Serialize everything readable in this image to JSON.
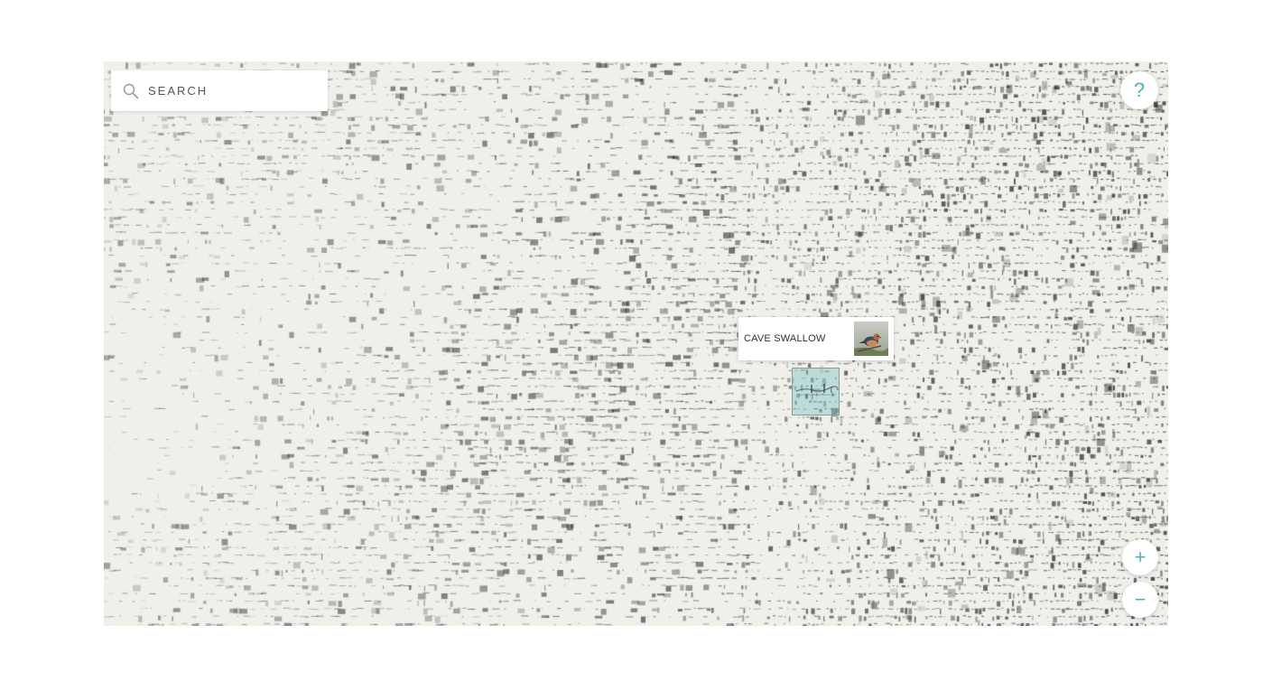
{
  "search": {
    "placeholder": "SEARCH",
    "icon": "search-icon"
  },
  "controls": {
    "help_label": "?",
    "zoom_in_label": "+",
    "zoom_out_label": "−"
  },
  "tooltip": {
    "species_name": "CAVE SWALLOW",
    "thumbnail_icon": "bird-photo-icon"
  },
  "colors": {
    "accent": "#4fb3b6",
    "map_background": "#f1efe9",
    "spectrogram_ink": "#1e1e1e"
  }
}
